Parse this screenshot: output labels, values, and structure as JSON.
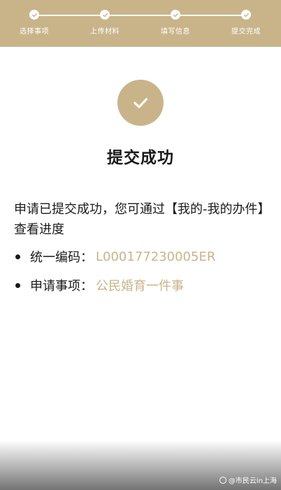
{
  "stepper": {
    "steps": [
      {
        "label": "选择事项"
      },
      {
        "label": "上传材料"
      },
      {
        "label": "填写信息"
      },
      {
        "label": "提交完成"
      }
    ]
  },
  "result": {
    "title": "提交成功",
    "message": "申请已提交成功，您可通过【我的-我的办件】查看进度"
  },
  "details": {
    "code_label": "统一编码：",
    "code_value": "L000177230005ER",
    "item_label": "申请事项：",
    "item_value": "公民婚育一件事"
  },
  "watermark": {
    "text": "@市民云in上海"
  },
  "colors": {
    "accent": "#c9b48a"
  }
}
